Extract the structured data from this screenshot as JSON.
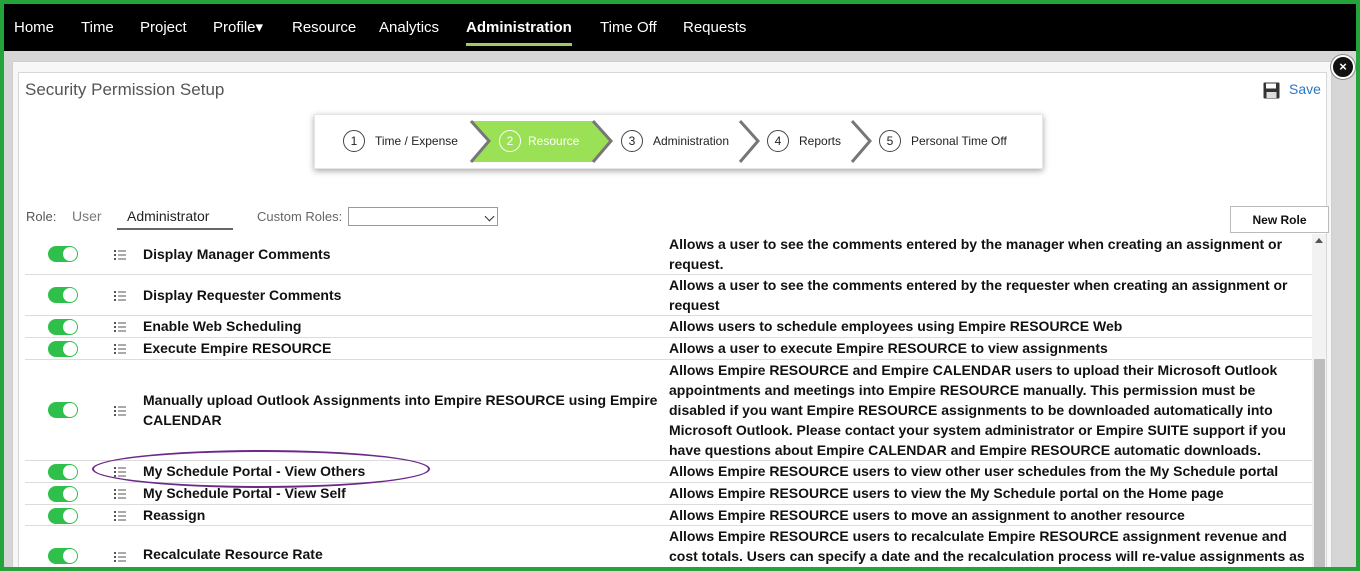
{
  "nav": {
    "items": [
      {
        "label": "Home"
      },
      {
        "label": "Time"
      },
      {
        "label": "Project"
      },
      {
        "label": "Profile▾"
      },
      {
        "label": "Resource"
      },
      {
        "label": "Analytics"
      },
      {
        "label": "Administration",
        "active": true
      },
      {
        "label": "Time Off"
      },
      {
        "label": "Requests"
      }
    ]
  },
  "page": {
    "title": "Security Permission Setup",
    "save_label": "Save",
    "close_glyph": "×",
    "new_role_label": "New Role"
  },
  "wizard": {
    "steps": [
      {
        "num": "1",
        "label": "Time / Expense"
      },
      {
        "num": "2",
        "label": "Resource",
        "active": true
      },
      {
        "num": "3",
        "label": "Administration"
      },
      {
        "num": "4",
        "label": "Reports"
      },
      {
        "num": "5",
        "label": "Personal Time Off"
      }
    ]
  },
  "roles": {
    "label": "Role:",
    "tabs": [
      {
        "label": "User"
      },
      {
        "label": "Administrator",
        "active": true
      }
    ],
    "custom_label": "Custom Roles:",
    "custom_value": ""
  },
  "permissions": [
    {
      "name": "Display Manager Comments",
      "desc": "Allows a user to see the comments entered by the manager when creating an assignment or request.",
      "enabled": true
    },
    {
      "name": "Display Requester Comments",
      "desc": "Allows a user to see the comments entered by the requester when creating an assignment or request",
      "enabled": true
    },
    {
      "name": "Enable Web Scheduling",
      "desc": "Allows users to schedule employees using Empire RESOURCE Web",
      "enabled": true
    },
    {
      "name": "Execute Empire RESOURCE",
      "desc": "Allows a user to execute Empire RESOURCE to view assignments",
      "enabled": true
    },
    {
      "name": "Manually upload Outlook Assignments into Empire RESOURCE using Empire CALENDAR",
      "desc": "Allows Empire RESOURCE and Empire CALENDAR users to upload their Microsoft Outlook appointments and meetings into Empire RESOURCE manually. This permission must be disabled if you want Empire RESOURCE assignments to be downloaded automatically into Microsoft Outlook. Please contact your system administrator or Empire SUITE support if you have questions about Empire CALENDAR and Empire RESOURCE automatic downloads.",
      "enabled": true
    },
    {
      "name": "My Schedule Portal - View Others",
      "desc": "Allows Empire RESOURCE users to view other user schedules from the My Schedule portal",
      "enabled": true
    },
    {
      "name": "My Schedule Portal - View Self",
      "desc": "Allows Empire RESOURCE users to view the My Schedule portal on the Home page",
      "enabled": true
    },
    {
      "name": "Reassign",
      "desc": "Allows Empire RESOURCE users to move an assignment to another resource",
      "enabled": true
    },
    {
      "name": "Recalculate Resource Rate",
      "desc": "Allows Empire RESOURCE users to recalculate Empire RESOURCE assignment revenue and cost totals. Users can specify a date and the recalculation process will re-value assignments as of the selected date based on revenue and cost rates.",
      "enabled": true
    }
  ],
  "colors": {
    "nav_bg": "#000000",
    "accent_green": "#2ec04a",
    "wizard_active": "#9be155",
    "annotation": "#6b2a8a",
    "link": "#2a78c4"
  }
}
